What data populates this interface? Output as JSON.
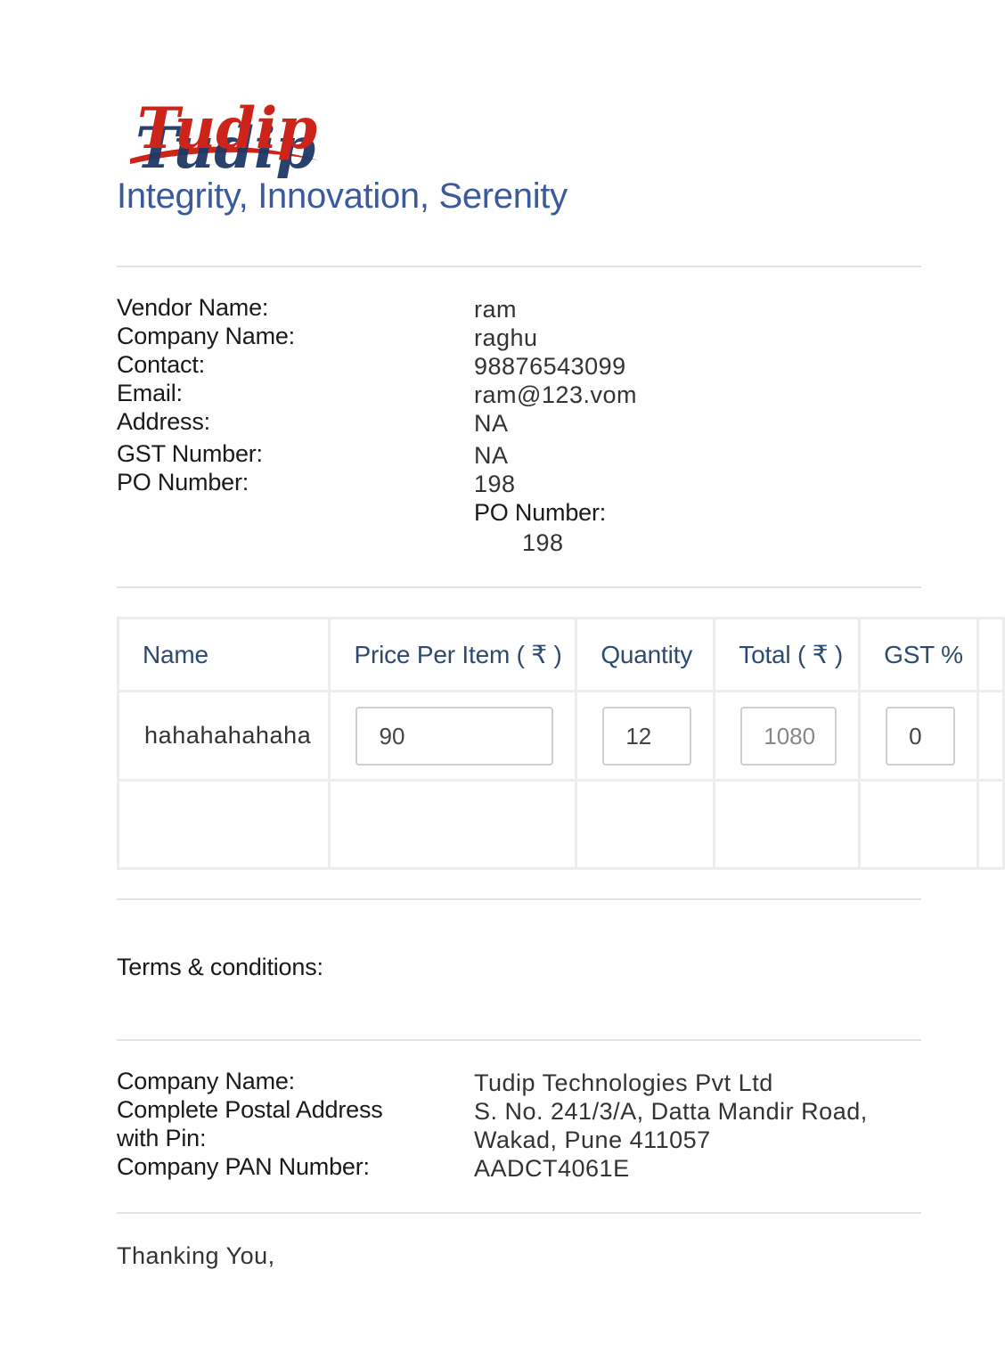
{
  "header": {
    "logo_text": "Tudip",
    "tagline": "Integrity, Innovation, Serenity"
  },
  "vendor": {
    "rows": [
      {
        "label": "Vendor Name:",
        "value": "ram"
      },
      {
        "label": "Company Name:",
        "value": "raghu"
      },
      {
        "label": "Contact:",
        "value": "98876543099"
      },
      {
        "label": "Email:",
        "value": "ram@123.vom"
      },
      {
        "label": "Address:",
        "value": "NA"
      },
      {
        "label": "GST Number:",
        "value": "NA"
      },
      {
        "label": "PO Number:",
        "value": "198"
      }
    ],
    "po_extra_label": "PO Number:",
    "po_extra_value": "198"
  },
  "items_table": {
    "headers": [
      "Name",
      "Price Per Item ( ₹ )",
      "Quantity",
      "Total ( ₹ )",
      "GST %"
    ],
    "rows": [
      {
        "name": "hahahahahaha",
        "price": "90",
        "quantity": "12",
        "total": "1080",
        "gst": "0"
      }
    ]
  },
  "terms": {
    "label": "Terms & conditions:"
  },
  "company": {
    "name_label": "Company Name:",
    "name_value": "Tudip Technologies Pvt Ltd",
    "address_label_1": "Complete Postal Address",
    "address_label_2": "with Pin:",
    "address_value_1": "S. No. 241/3/A, Datta Mandir Road,",
    "address_value_2": "Wakad, Pune 411057",
    "pan_label": "Company PAN Number:",
    "pan_value": "AADCT4061E"
  },
  "closing": "Thanking You,",
  "colors": {
    "tagline": "#3a5a9c",
    "logo_red": "#cc2418",
    "logo_navy": "#1d3766",
    "table_header": "#2e4a70"
  }
}
